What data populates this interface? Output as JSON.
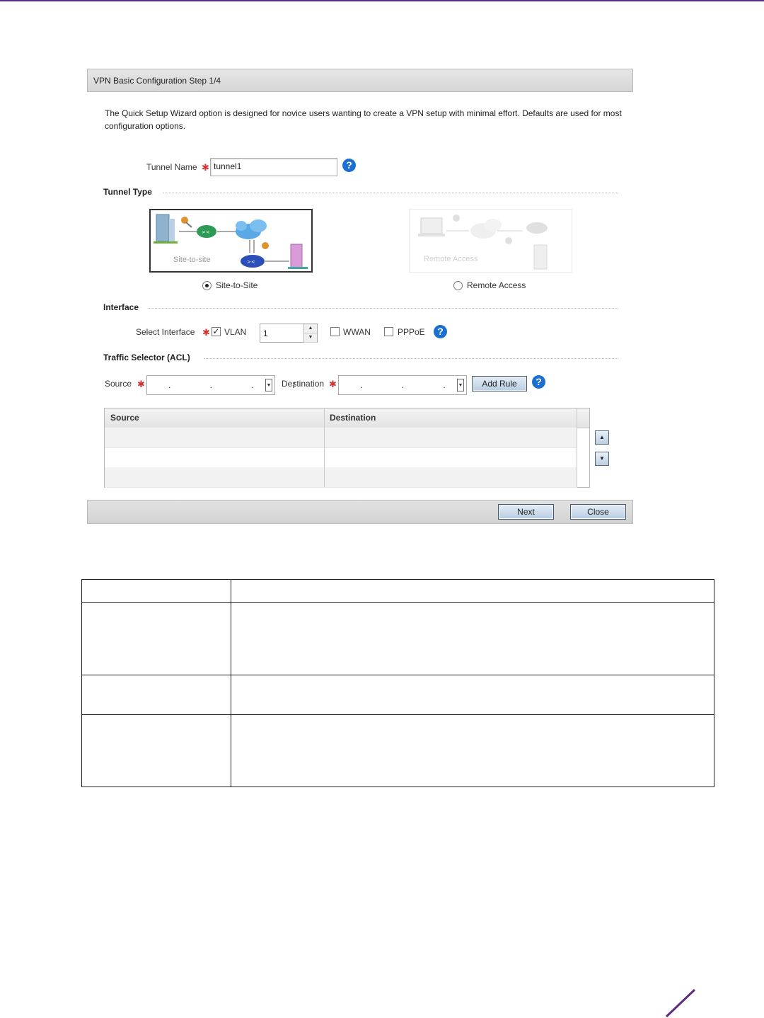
{
  "wizard": {
    "title": "VPN Basic Configuration  Step 1/4",
    "intro": "The Quick Setup Wizard option is designed for novice users wanting to create a VPN setup with minimal effort. Defaults are used for most configuration options.",
    "tunnel_name_label": "Tunnel Name",
    "tunnel_name_value": "tunnel1",
    "tunnel_type_heading": "Tunnel Type",
    "site_card_caption": "Site-to-site",
    "remote_card_caption": "Remote Access",
    "site_radio_label": "Site-to-Site",
    "remote_radio_label": "Remote Access",
    "tunnel_type_selected": "Site-to-Site",
    "interface_heading": "Interface",
    "select_interface_label": "Select Interface",
    "vlan_label": "VLAN",
    "vlan_checked": true,
    "vlan_value": "1",
    "wwan_label": "WWAN",
    "wwan_checked": false,
    "pppoe_label": "PPPoE",
    "pppoe_checked": false,
    "traffic_heading": "Traffic Selector (ACL)",
    "source_label": "Source",
    "destination_label": "Destination",
    "ip_placeholder": ". . . /",
    "add_rule_label": "Add Rule",
    "grid_columns": [
      "Source",
      "Destination"
    ],
    "grid_rows": [],
    "next_label": "Next",
    "close_label": "Close",
    "help_glyph": "?",
    "check_glyph": "✓",
    "dropdown_glyph": "▼",
    "up_glyph": "▲",
    "down_glyph": "▼"
  },
  "icons": {
    "help": "help-icon",
    "site_to_site": "site-to-site-diagram",
    "remote_access": "remote-access-diagram"
  },
  "colors": {
    "accent": "#5b2c83",
    "help_blue": "#1a6fd1",
    "required": "#d63030"
  }
}
